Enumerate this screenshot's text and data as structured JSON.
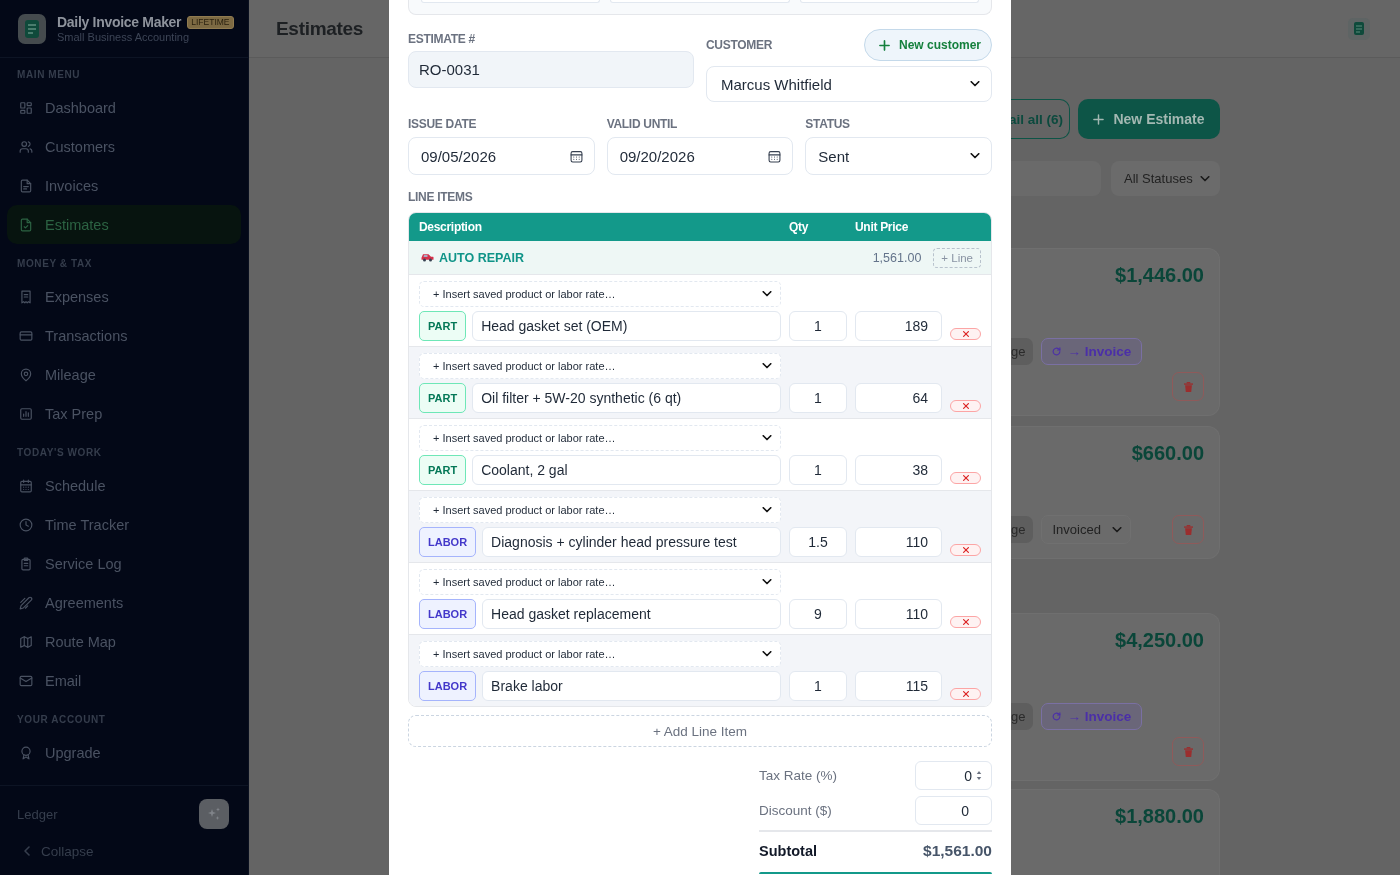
{
  "sidebar": {
    "app_name": "Daily Invoice Maker",
    "badge": "LIFETIME",
    "tagline": "Small Business Accounting",
    "sections": [
      {
        "title": "MAIN MENU",
        "items": [
          {
            "label": "Dashboard",
            "selected": false
          },
          {
            "label": "Customers",
            "selected": false
          },
          {
            "label": "Invoices",
            "selected": false
          },
          {
            "label": "Estimates",
            "selected": true
          }
        ]
      },
      {
        "title": "MONEY & TAX",
        "items": [
          {
            "label": "Expenses",
            "selected": false
          },
          {
            "label": "Transactions",
            "selected": false
          },
          {
            "label": "Mileage",
            "selected": false
          },
          {
            "label": "Tax Prep",
            "selected": false
          }
        ]
      },
      {
        "title": "TODAY'S WORK",
        "items": [
          {
            "label": "Schedule",
            "selected": false
          },
          {
            "label": "Time Tracker",
            "selected": false
          },
          {
            "label": "Service Log",
            "selected": false
          },
          {
            "label": "Agreements",
            "selected": false
          },
          {
            "label": "Route Map",
            "selected": false
          },
          {
            "label": "Email",
            "selected": false
          }
        ]
      },
      {
        "title": "YOUR ACCOUNT",
        "items": [
          {
            "label": "Upgrade",
            "selected": false
          }
        ]
      }
    ],
    "footer": {
      "label": "Ledger",
      "collapse": "Collapse"
    }
  },
  "header": {
    "title": "Estimates"
  },
  "toolbar": {
    "buttons": [
      {
        "kind": "outline",
        "label": "ail all (6)"
      },
      {
        "kind": "primary",
        "label": "New Estimate"
      }
    ]
  },
  "filters": {
    "status": "All Statuses"
  },
  "cards": [
    {
      "amount": "$1,446.00",
      "actions": [
        {
          "kind": "pill",
          "label": "ge"
        },
        {
          "kind": "convert",
          "label": "→ Invoice"
        }
      ]
    },
    {
      "amount": "$660.00",
      "actions": [
        {
          "kind": "pill",
          "label": "ge"
        },
        {
          "kind": "status",
          "label": "Invoiced"
        }
      ]
    },
    {
      "amount": "$4,250.00",
      "actions": [
        {
          "kind": "pill",
          "label": "ge"
        },
        {
          "kind": "convert",
          "label": "→ Invoice"
        }
      ]
    },
    {
      "amount": "$1,880.00"
    }
  ],
  "modal": {
    "estimate_number": {
      "label": "ESTIMATE #",
      "value": "RO-0031"
    },
    "customer": {
      "label": "CUSTOMER",
      "value": "Marcus Whitfield",
      "new_button": "New customer"
    },
    "issue_date": {
      "label": "ISSUE DATE",
      "value": "09/05/2026"
    },
    "valid_until": {
      "label": "VALID UNTIL",
      "value": "09/20/2026"
    },
    "status": {
      "label": "STATUS",
      "value": "Sent"
    },
    "line_items": {
      "label": "LINE ITEMS",
      "columns": [
        "Description",
        "Qty",
        "Unit Price"
      ],
      "groups": [
        {
          "name": "AUTO REPAIR",
          "total": "1,561.00",
          "add_button": "+ Line",
          "items": [
            {
              "kind": "part",
              "tag": "PART",
              "insert_placeholder": "+ Insert saved product or labor rate…",
              "description": "Head gasket set (OEM)",
              "qty": "1",
              "unit_price": "189"
            },
            {
              "kind": "part",
              "tag": "PART",
              "insert_placeholder": "+ Insert saved product or labor rate…",
              "description": "Oil filter + 5W-20 synthetic (6 qt)",
              "qty": "1",
              "unit_price": "64"
            },
            {
              "kind": "part",
              "tag": "PART",
              "insert_placeholder": "+ Insert saved product or labor rate…",
              "description": "Coolant, 2 gal",
              "qty": "1",
              "unit_price": "38"
            },
            {
              "kind": "labor",
              "tag": "LABOR",
              "insert_placeholder": "+ Insert saved product or labor rate…",
              "description": "Diagnosis + cylinder head pressure test",
              "qty": "1.5",
              "unit_price": "110"
            },
            {
              "kind": "labor",
              "tag": "LABOR",
              "insert_placeholder": "+ Insert saved product or labor rate…",
              "description": "Head gasket replacement",
              "qty": "9",
              "unit_price": "110"
            },
            {
              "kind": "labor",
              "tag": "LABOR",
              "insert_placeholder": "+ Insert saved product or labor rate…",
              "description": "Brake labor",
              "qty": "1",
              "unit_price": "115"
            }
          ]
        }
      ]
    },
    "add_line_item": "+ Add Line Item",
    "tax_rate": {
      "label": "Tax Rate (%)",
      "value": "0"
    },
    "discount": {
      "label": "Discount ($)",
      "value": "0"
    },
    "subtotal": {
      "label": "Subtotal",
      "value": "$1,561.00"
    }
  }
}
